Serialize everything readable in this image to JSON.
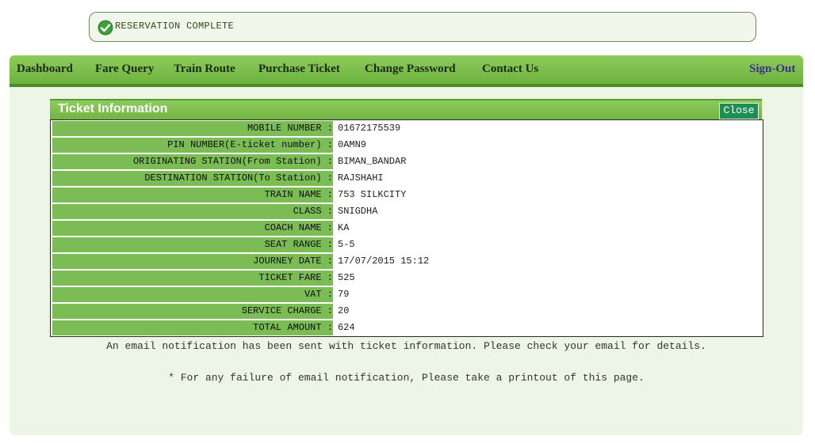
{
  "status": {
    "message": "RESERVATION COMPLETE",
    "icon": "check-circle-icon",
    "color": "#2f8a2f"
  },
  "nav": {
    "items": [
      "Dashboard",
      "Fare Query",
      "Train Route",
      "Purchase Ticket",
      "Change Password",
      "Contact Us"
    ],
    "signout": "Sign-Out"
  },
  "ticket": {
    "title": "Ticket Information",
    "close_label": "Close",
    "rows": [
      {
        "label": "MOBILE NUMBER :",
        "value": "01672175539"
      },
      {
        "label": "PIN NUMBER(E-ticket number) :",
        "value": "0AMN9"
      },
      {
        "label": "ORIGINATING STATION(From Station) :",
        "value": "BIMAN_BANDAR"
      },
      {
        "label": "DESTINATION STATION(To Station) :",
        "value": "RAJSHAHI"
      },
      {
        "label": "TRAIN NAME :",
        "value": "753 SILKCITY"
      },
      {
        "label": "CLASS :",
        "value": "SNIGDHA"
      },
      {
        "label": "COACH NAME :",
        "value": "KA"
      },
      {
        "label": "SEAT RANGE :",
        "value": "5-5"
      },
      {
        "label": "JOURNEY DATE :",
        "value": "17/07/2015 15:12"
      },
      {
        "label": "TICKET FARE :",
        "value": "525"
      },
      {
        "label": "VAT :",
        "value": "79"
      },
      {
        "label": "SERVICE CHARGE :",
        "value": "20"
      },
      {
        "label": "TOTAL AMOUNT :",
        "value": "624"
      }
    ]
  },
  "notes": {
    "email": "An email notification has been sent with ticket information. Please check your email for details.",
    "printout": "* For any failure of email notification, Please take a printout of this page."
  }
}
